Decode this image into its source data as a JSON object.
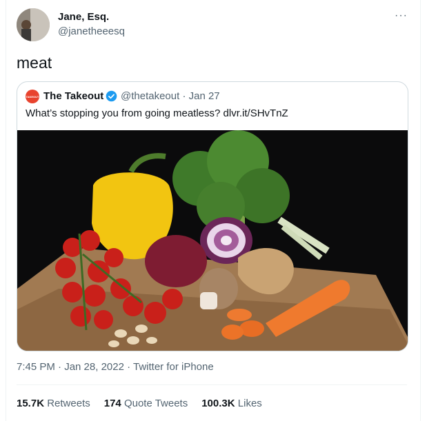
{
  "author": {
    "display_name": "Jane, Esq.",
    "handle": "@janetheeesq",
    "avatar_icon": "avatar-photo"
  },
  "more_label": "···",
  "tweet_text": "meat",
  "quote": {
    "logo_text": "TAKEOUT",
    "name": "The Takeout",
    "verified_icon": "verified-badge-icon",
    "handle": "@thetakeout",
    "date": "Jan 27",
    "meta": "@thetakeout · Jan 27",
    "text": "What’s stopping you from going meatless? dlvr.it/SHvTnZ",
    "image_description_icon": "vegetables-photo"
  },
  "timestamp": "7:45 PM · Jan 28, 2022 · Twitter for iPhone",
  "stats": {
    "retweets_count": "15.7K",
    "retweets_label": "Retweets",
    "quotes_count": "174",
    "quotes_label": "Quote Tweets",
    "likes_count": "100.3K",
    "likes_label": "Likes"
  },
  "colors": {
    "text": "#0f1419",
    "secondary": "#536471",
    "verified": "#1d9bf0",
    "takeout_red": "#e8432e"
  }
}
